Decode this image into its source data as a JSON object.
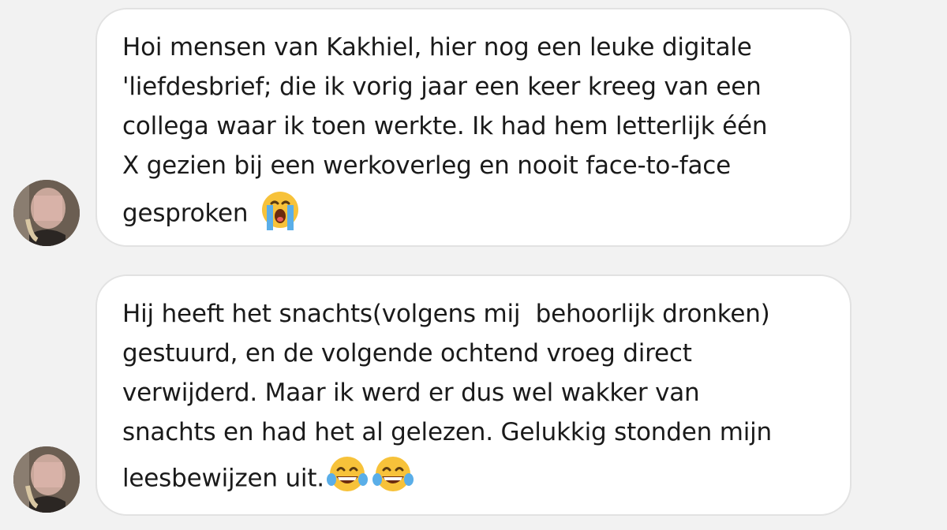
{
  "messages": [
    {
      "lines": [
        "Hoi mensen van Kakhiel, hier nog een leuke digitale",
        "'liefdesbrief; die ik vorig jaar een keer kreeg van een",
        "collega waar ik toen werkte. Ik had hem letterlijk één",
        "X gezien bij een werkoverleg en nooit face-to-face",
        "gesproken "
      ],
      "emojis": [
        "loudly-crying-face"
      ]
    },
    {
      "lines": [
        "Hij heeft het snachts(volgens mij  behoorlijk dronken)",
        "gestuurd, en de volgende ochtend vroeg direct",
        "verwijderd. Maar ik werd er dus wel wakker van",
        "snachts en had het al gelezen. Gelukkig stonden mijn",
        "leesbewijzen uit."
      ],
      "emojis": [
        "face-with-tears-of-joy",
        "face-with-tears-of-joy"
      ]
    }
  ],
  "colors": {
    "background": "#f2f2f2",
    "bubble": "#ffffff",
    "bubble_border": "#e2e2e2",
    "text": "#1a1a1a",
    "emoji_yellow": "#f7c23a",
    "emoji_tears": "#5aaee8"
  }
}
